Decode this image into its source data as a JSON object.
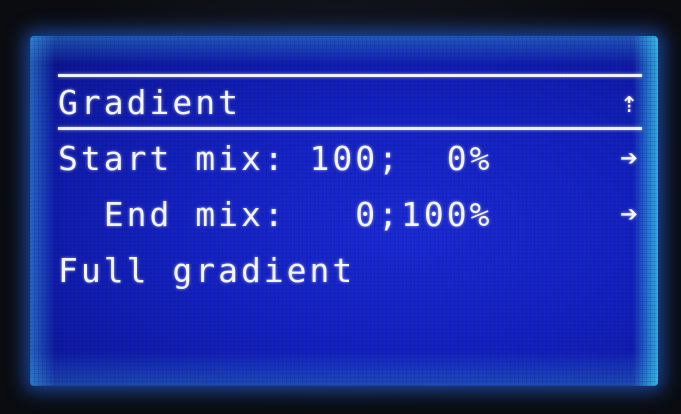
{
  "menu": {
    "title": "Gradient",
    "back_icon": "up-return-arrow-icon",
    "items": [
      {
        "label": "Start mix: 100;  0%",
        "icon": "right-arrow-icon"
      },
      {
        "label": "  End mix:   0;100%",
        "icon": "right-arrow-icon"
      },
      {
        "label": "Full gradient",
        "icon": ""
      }
    ]
  },
  "colors": {
    "lcd_background": "#1422c4",
    "text": "#f4f6ff",
    "backlight_glow": "#3caaff"
  }
}
